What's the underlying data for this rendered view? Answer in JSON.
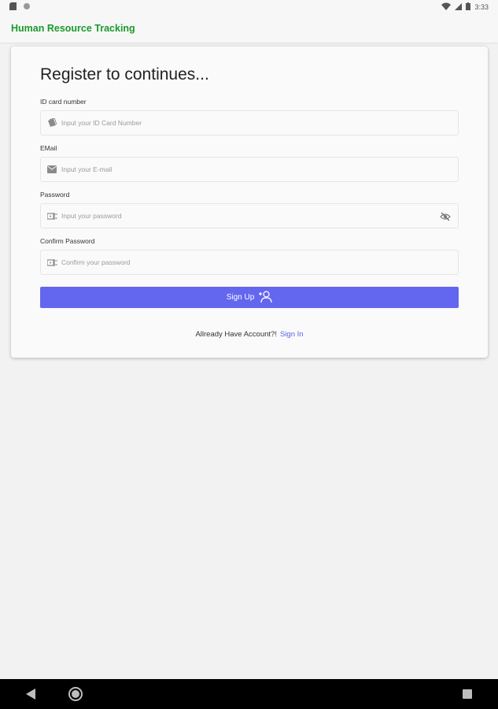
{
  "status_bar": {
    "time": "3:33"
  },
  "app_bar": {
    "title": "Human Resource Tracking",
    "title_color": "#1a9a2c"
  },
  "form": {
    "title": "Register to continues...",
    "fields": [
      {
        "label": "ID card number",
        "placeholder": "Input your ID Card Number",
        "icon": "id-card-icon"
      },
      {
        "label": "EMail",
        "placeholder": "Input your E-mail",
        "icon": "mail-icon"
      },
      {
        "label": "Password",
        "placeholder": "Input your password",
        "icon": "password-icon"
      },
      {
        "label": "Confirm Password",
        "placeholder": "Confirm your password",
        "icon": "password-icon"
      }
    ],
    "signup_label": "Sign Up",
    "signup_color": "#6366ee",
    "signin_prompt": "Allready Have Account?!",
    "signin_link": "Sign In"
  }
}
